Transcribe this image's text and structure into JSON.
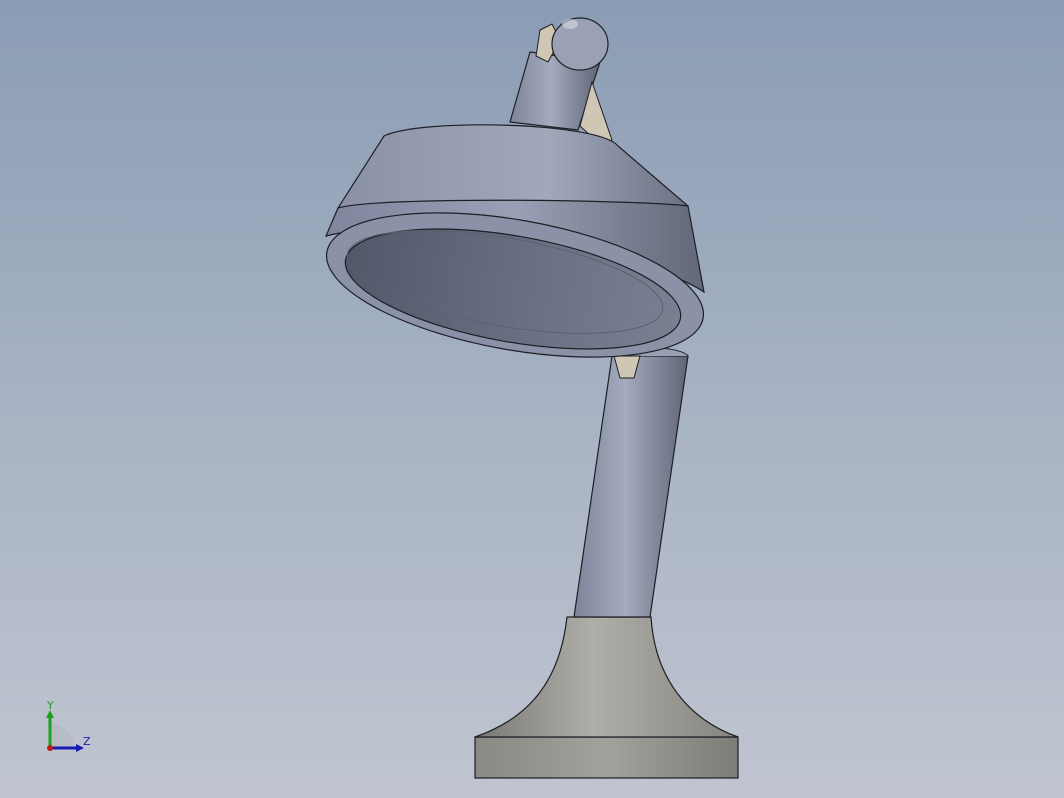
{
  "viewport": {
    "background_top": "#8a9cb4",
    "background_bottom": "#c0c5d0"
  },
  "model": {
    "name": "desk-lamp",
    "colors": {
      "body": "#8a91a8",
      "body_dark": "#5f6577",
      "body_light": "#a3a9bd",
      "hinge": "#cfc6b3",
      "base": "#a19f99",
      "base_dark": "#7b7974",
      "outline": "#1d1f25"
    }
  },
  "triad": {
    "y_label": "Y",
    "z_label": "Z",
    "y_color": "#1aa31a",
    "z_color": "#1a1ab4",
    "x_color": "#c01818"
  }
}
